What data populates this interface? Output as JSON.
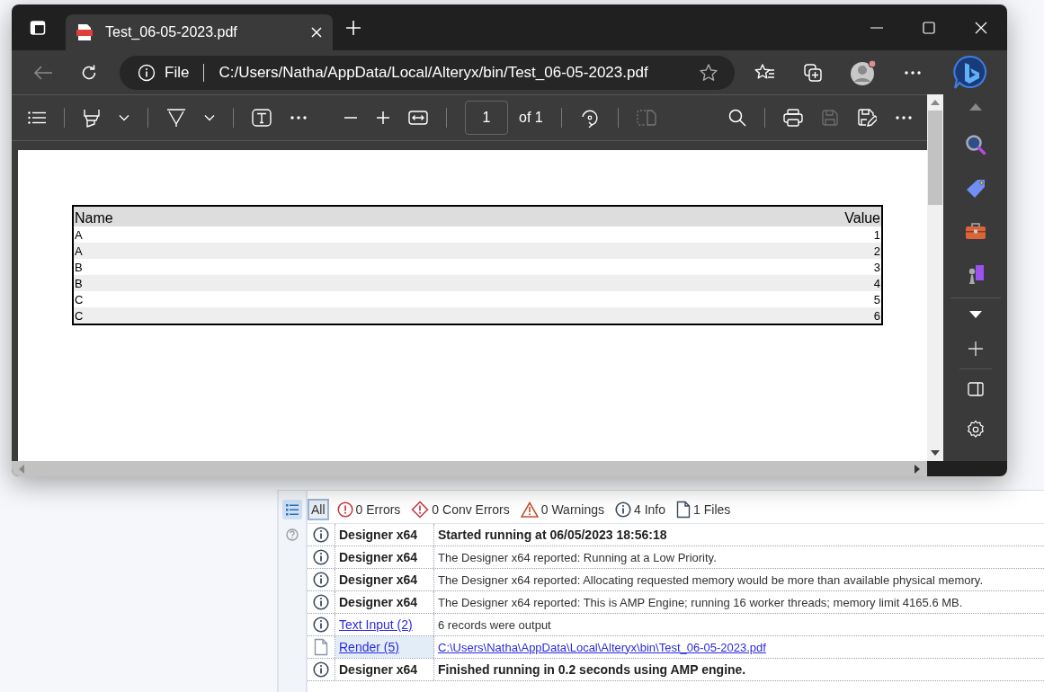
{
  "browser": {
    "tab": {
      "title": "Test_06-05-2023.pdf"
    },
    "address": {
      "scheme": "File",
      "url": "C:/Users/Natha/AppData/Local/Alteryx/bin/Test_06-05-2023.pdf"
    },
    "pdf_toolbar": {
      "page": "1",
      "page_count": "of 1"
    },
    "pdf_table": {
      "columns": [
        "Name",
        "Value"
      ],
      "rows": [
        [
          "A",
          "1"
        ],
        [
          "A",
          "2"
        ],
        [
          "B",
          "3"
        ],
        [
          "B",
          "4"
        ],
        [
          "C",
          "5"
        ],
        [
          "C",
          "6"
        ]
      ]
    }
  },
  "messages": {
    "filters": [
      {
        "kind": "all",
        "label": "All",
        "selected": true
      },
      {
        "kind": "error",
        "label": "0 Errors",
        "selected": false
      },
      {
        "kind": "conv",
        "label": "0 Conv Errors",
        "selected": false
      },
      {
        "kind": "warning",
        "label": "0 Warnings",
        "selected": false
      },
      {
        "kind": "info",
        "label": "4 Info",
        "selected": false
      },
      {
        "kind": "file",
        "label": "1 Files",
        "selected": false
      }
    ],
    "rows": [
      {
        "kind": "info",
        "source": "Designer x64",
        "source_link": false,
        "message": "Started running at 06/05/2023 18:56:18",
        "message_link": false,
        "bold": true,
        "selected": false
      },
      {
        "kind": "info",
        "source": "Designer x64",
        "source_link": false,
        "message": "The Designer x64 reported: Running at a Low Priority.",
        "message_link": false,
        "bold": false,
        "selected": false
      },
      {
        "kind": "info",
        "source": "Designer x64",
        "source_link": false,
        "message": "The Designer x64 reported: Allocating requested memory would be more than available physical memory.",
        "message_link": false,
        "bold": false,
        "selected": false
      },
      {
        "kind": "info",
        "source": "Designer x64",
        "source_link": false,
        "message": "The Designer x64 reported: This is AMP Engine; running 16 worker threads; memory limit 4165.6 MB.",
        "message_link": false,
        "bold": false,
        "selected": false
      },
      {
        "kind": "info",
        "source": "Text Input (2)",
        "source_link": true,
        "message": "6 records were output",
        "message_link": false,
        "bold": false,
        "selected": false
      },
      {
        "kind": "file",
        "source": "Render (5)",
        "source_link": true,
        "message": "C:\\Users\\Natha\\AppData\\Local\\Alteryx\\bin\\Test_06-05-2023.pdf",
        "message_link": true,
        "bold": false,
        "selected": true
      },
      {
        "kind": "info",
        "source": "Designer x64",
        "source_link": false,
        "message": "Finished running in 0.2 seconds using AMP engine.",
        "message_link": false,
        "bold": true,
        "selected": false
      }
    ]
  }
}
